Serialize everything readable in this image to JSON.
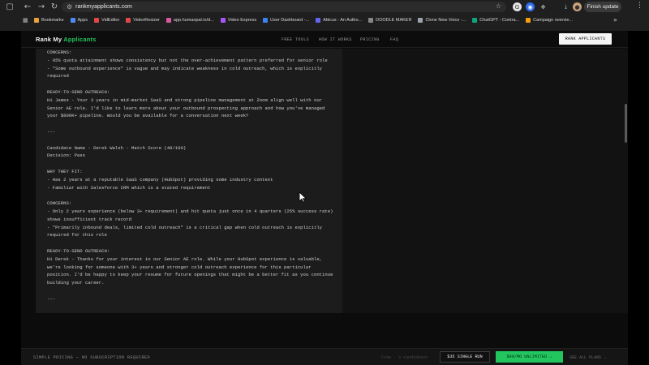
{
  "browser": {
    "url": "rankmyapplicants.com",
    "update_label": "Finish update",
    "bookmarks": [
      {
        "label": "Bookmarks",
        "color": "#e8a23a"
      },
      {
        "label": "Apps",
        "color": "#4c8bf5"
      },
      {
        "label": "VidEditor",
        "color": "#e04848"
      },
      {
        "label": "VideoResizer",
        "color": "#e04848"
      },
      {
        "label": "app.humanpal.io/d...",
        "color": "#d65aa0"
      },
      {
        "label": "Video Express",
        "color": "#a855f7"
      },
      {
        "label": "User Dashboard -...",
        "color": "#3b82f6"
      },
      {
        "label": "Atticus - An Autho...",
        "color": "#6366f1"
      },
      {
        "label": "DOODLE MAKER",
        "color": "#888888"
      },
      {
        "label": "Clone New Voice -...",
        "color": "#9ca3af"
      },
      {
        "label": "ChatGPT - Contra...",
        "color": "#10a37f"
      },
      {
        "label": "Campaign overvie...",
        "color": "#f59e0b"
      }
    ]
  },
  "header": {
    "logo_main": "Rank My ",
    "logo_accent": "Applicants",
    "nav": [
      "FREE TOOLS",
      "HOW IT WORKS",
      "PRICING",
      "FAQ"
    ],
    "cta_label": "RANK APPLICANTS",
    "accent_color": "#22c55e"
  },
  "results": {
    "lines": [
      "CONCERNS:",
      "- 95% quota attainment shows consistency but not the over-achievement pattern preferred for senior role",
      "- \"Some outbound experience\" is vague and may indicate weakness in cold outreach, which is explicitly",
      "required",
      "",
      "READY-TO-SEND OUTREACH:",
      "Hi James - Your 3 years in mid-market SaaS and strong pipeline management at Zoom align well with our",
      "Senior AE role. I'd like to learn more about your outbound prospecting approach and how you've managed",
      "your $800K+ pipeline. Would you be available for a conversation next week?",
      "",
      "---",
      "",
      "Candidate Name - Derek Walsh - Match Score (48/100)",
      "Decision: Pass",
      "",
      "WHY THEY FIT:",
      "- Has 2 years at a reputable SaaS company (HubSpot) providing some industry context",
      "- Familiar with Salesforce CRM which is a stated requirement",
      "",
      "CONCERNS:",
      "- Only 2 years experience (below 3+ requirement) and hit quota just once in 4 quarters (25% success rate)",
      "shows insufficient track record",
      "- \"Primarily inbound deals, limited cold outreach\" is a critical gap when cold outreach is explicitly",
      "required for this role",
      "",
      "READY-TO-SEND OUTREACH:",
      "Hi Derek - Thanks for your interest in our Senior AE role. While your HubSpot experience is valuable,",
      "we're looking for someone with 3+ years and stronger cold outreach experience for this particular",
      "position. I'd be happy to keep your resume for future openings that might be a better fit as you continue",
      "building your career.",
      "",
      "---"
    ]
  },
  "pricing": {
    "label": "SIMPLE PRICING — NO SUBSCRIPTION REQUIRED",
    "free_note": "Free · 3 candidates",
    "single_run": "$35 SINGLE RUN",
    "unlimited": "$99/MO UNLIMITED →",
    "see_all": "SEE ALL PLANS →"
  }
}
